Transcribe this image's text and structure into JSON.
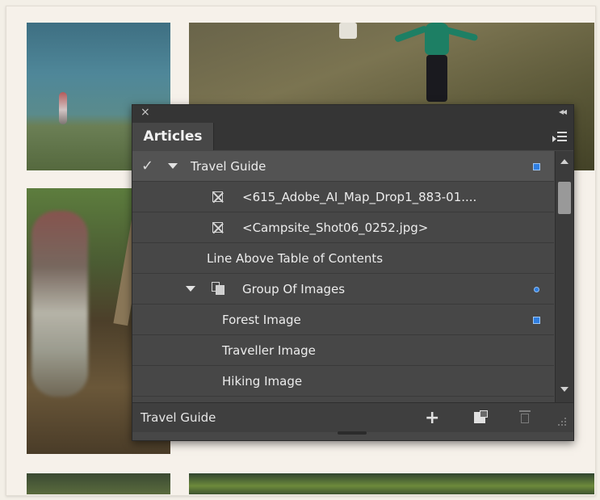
{
  "panel": {
    "tab_label": "Articles",
    "close_glyph": "×",
    "collapse_glyph": "◂◂",
    "footer_label": "Travel Guide",
    "footer_buttons": {
      "add": "+",
      "new_article_icon": "new-article-icon",
      "delete_icon": "trash-icon"
    }
  },
  "rows": [
    {
      "label": "Travel Guide",
      "type": "article",
      "checked": true,
      "expanded": true,
      "selected": true,
      "marker": "blue-square"
    },
    {
      "label": "<615_Adobe_AI_Map_Drop1_883-01....",
      "type": "frame"
    },
    {
      "label": "<Campsite_Shot06_0252.jpg>",
      "type": "frame"
    },
    {
      "label": "Line Above Table of Contents",
      "type": "text"
    },
    {
      "label": "Group Of Images",
      "type": "group",
      "expanded": true,
      "marker": "blue-dot"
    },
    {
      "label": "Forest Image",
      "type": "child",
      "marker": "blue-square"
    },
    {
      "label": "Traveller Image",
      "type": "child"
    },
    {
      "label": "Hiking Image",
      "type": "child"
    }
  ],
  "colors": {
    "panel_bg": "#474747",
    "selection": "#535353",
    "marker_blue": "#2f7ee0"
  }
}
